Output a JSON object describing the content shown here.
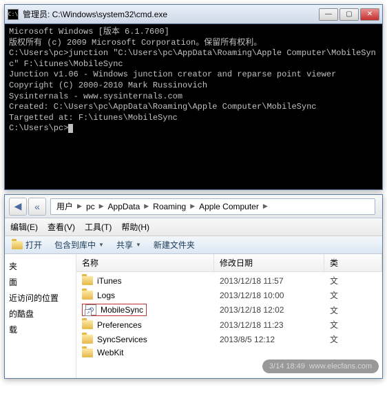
{
  "cmd": {
    "title": "管理员: C:\\Windows\\system32\\cmd.exe",
    "icon_label": "C:\\",
    "lines": [
      "Microsoft Windows [版本 6.1.7600]",
      "版权所有 (c) 2009 Microsoft Corporation。保留所有权利。",
      "",
      "C:\\Users\\pc>junction \"C:\\Users\\pc\\AppData\\Roaming\\Apple Computer\\MobileSync\" F:\\itunes\\MobileSync",
      "",
      "Junction v1.06 - Windows junction creator and reparse point viewer",
      "Copyright (C) 2000-2010 Mark Russinovich",
      "Sysinternals - www.sysinternals.com",
      "",
      "Created: C:\\Users\\pc\\AppData\\Roaming\\Apple Computer\\MobileSync",
      "Targetted at: F:\\itunes\\MobileSync",
      "",
      "C:\\Users\\pc>"
    ],
    "buttons": {
      "min": "—",
      "max": "▢",
      "close": "✕"
    }
  },
  "explorer": {
    "nav": {
      "back": "◀",
      "chev": "«"
    },
    "breadcrumb": [
      "用户",
      "pc",
      "AppData",
      "Roaming",
      "Apple Computer"
    ],
    "menu": {
      "edit": "编辑(E)",
      "view": "查看(V)",
      "tools": "工具(T)",
      "help": "帮助(H)"
    },
    "toolbar": {
      "open": "打开",
      "include": "包含到库中",
      "share": "共享",
      "newfolder": "新建文件夹"
    },
    "sidebar": [
      "夹",
      "面",
      "近访问的位置",
      "的酷盘",
      "载"
    ],
    "columns": {
      "name": "名称",
      "date": "修改日期",
      "type": "类"
    },
    "files": [
      {
        "name": "iTunes",
        "date": "2013/12/18 11:57",
        "type": "文",
        "icon": "folder"
      },
      {
        "name": "Logs",
        "date": "2013/12/18 10:00",
        "type": "文",
        "icon": "folder"
      },
      {
        "name": "MobileSync",
        "date": "2013/12/18 12:02",
        "type": "文",
        "icon": "shortcut",
        "selected": true
      },
      {
        "name": "Preferences",
        "date": "2013/12/18 11:23",
        "type": "文",
        "icon": "folder"
      },
      {
        "name": "SyncServices",
        "date": "2013/8/5 12:12",
        "type": "文",
        "icon": "folder"
      },
      {
        "name": "WebKit",
        "date": "",
        "type": "",
        "icon": "folder"
      }
    ]
  },
  "watermark": {
    "time": "3/14 18:49",
    "site": "www.elecfans.com"
  }
}
